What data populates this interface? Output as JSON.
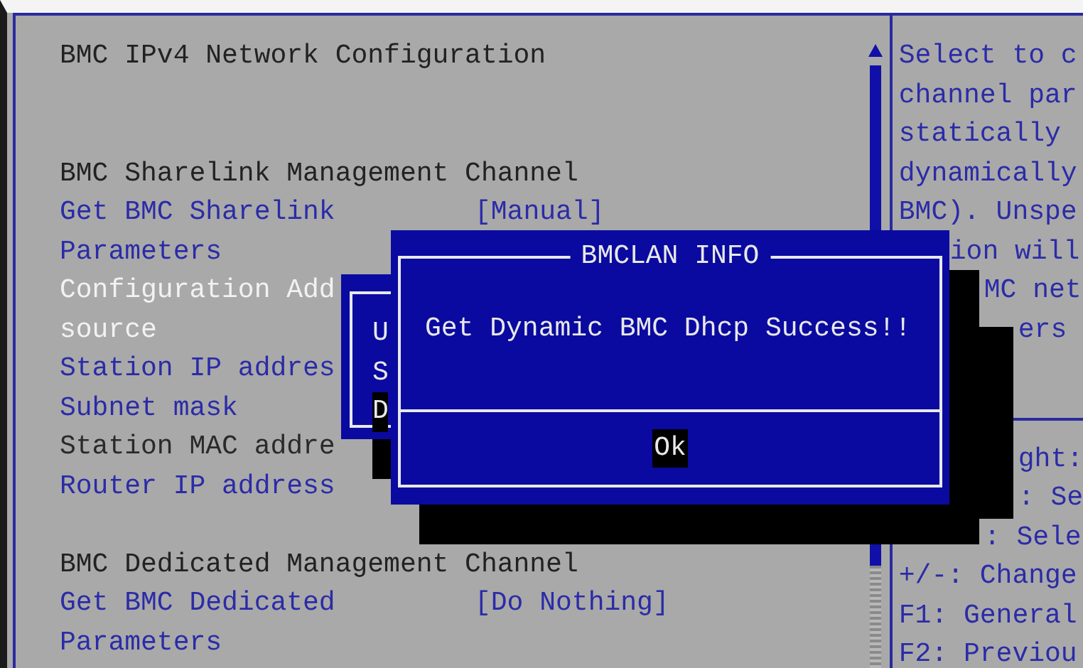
{
  "main_panel": {
    "title": "BMC IPv4 Network Configuration",
    "rows": [
      {
        "kind": "heading",
        "label": "BMC Sharelink Management Channel"
      },
      {
        "kind": "option",
        "label": "Get BMC Sharelink",
        "value": "[Manual]",
        "selected": false
      },
      {
        "kind": "option",
        "label": "Parameters",
        "selected": false
      },
      {
        "kind": "option",
        "label": "Configuration Add",
        "selected": true
      },
      {
        "kind": "option",
        "label": "source",
        "selected": true
      },
      {
        "kind": "option",
        "label": "Station IP addres",
        "selected": false
      },
      {
        "kind": "option",
        "label": "Subnet mask",
        "selected": false
      },
      {
        "kind": "info",
        "label": "Station MAC addre"
      },
      {
        "kind": "option",
        "label": "Router IP address",
        "selected": false
      },
      {
        "kind": "blank"
      },
      {
        "kind": "heading",
        "label": "BMC Dedicated Management Channel"
      },
      {
        "kind": "option",
        "label": "Get BMC Dedicated",
        "value": "[Do Nothing]",
        "selected": false
      },
      {
        "kind": "option",
        "label": "Parameters",
        "selected": false
      }
    ]
  },
  "help_panel": {
    "description": [
      {
        "kind": "plain",
        "text": "Select to c"
      },
      {
        "kind": "plain",
        "text": "channel par"
      },
      {
        "kind": "plain",
        "text": "statically"
      },
      {
        "kind": "plain",
        "text": "dynamically"
      },
      {
        "kind": "plain",
        "text": "BMC). Unspe"
      },
      {
        "kind": "obscured",
        "text": "ion will"
      },
      {
        "kind": "shadowed",
        "text": "MC net"
      },
      {
        "kind": "deep",
        "text": "ers"
      }
    ],
    "keys": [
      {
        "kind": "deep",
        "text": "ght:"
      },
      {
        "kind": "deep",
        "text": ": Se"
      },
      {
        "kind": "shadowed",
        "text": ": Sele"
      },
      {
        "kind": "plain",
        "text": "+/-: Change"
      },
      {
        "kind": "plain",
        "text": "F1: General"
      },
      {
        "kind": "plain",
        "text": "F2: Previou"
      }
    ]
  },
  "background_dialog": {
    "lines": [
      {
        "text": "U",
        "selected": false
      },
      {
        "text": "S",
        "selected": false
      },
      {
        "text": "D",
        "selected": true
      }
    ]
  },
  "dialog": {
    "title": "BMCLAN INFO",
    "message": "Get Dynamic BMC Dhcp Success!!",
    "buttons": [
      {
        "label": "Ok",
        "selected": true
      }
    ]
  }
}
